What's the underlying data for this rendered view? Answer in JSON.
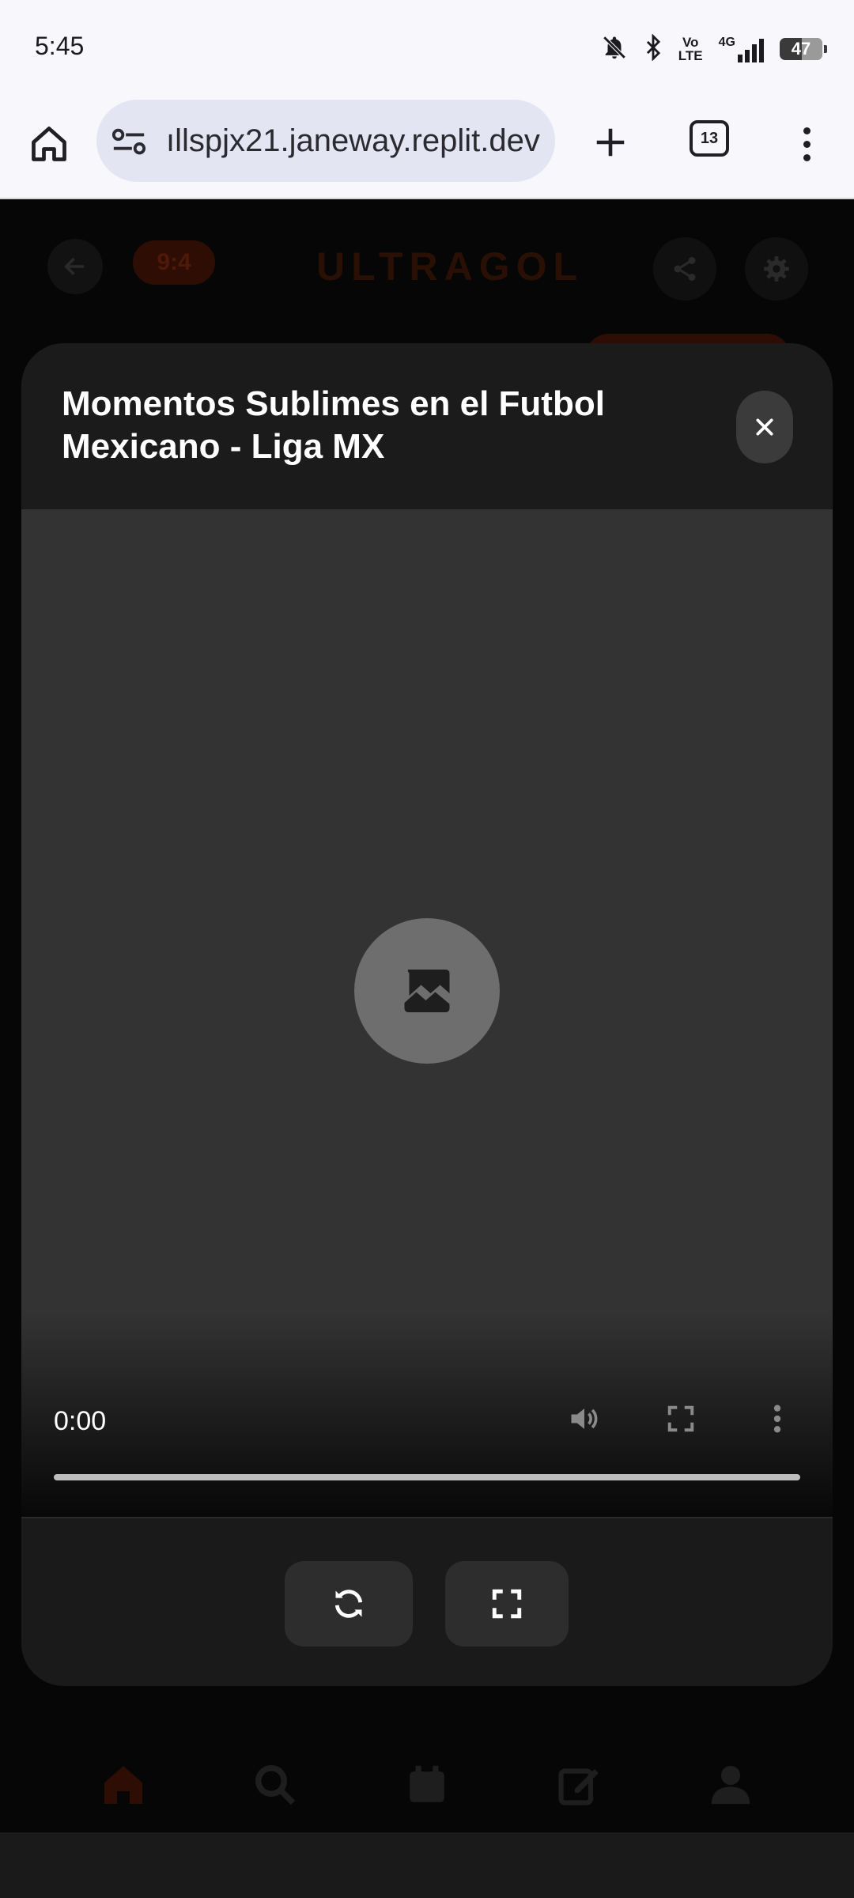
{
  "status_bar": {
    "time": "5:45",
    "volte": "Vo\nLTE",
    "network": "4G",
    "battery": "47"
  },
  "browser": {
    "url": "ıllspjx21.janeway.replit.dev",
    "tab_count": "13"
  },
  "app": {
    "score_badge": "9:4",
    "logo": "ULTRAGOL"
  },
  "modal": {
    "title": "Momentos Sublimes en el Futbol Mexicano - Liga MX",
    "close_symbol": "✕"
  },
  "player": {
    "time": "0:00",
    "progress": 0
  },
  "colors": {
    "accent": "#ff4500",
    "modal_bg": "#1a1a1a",
    "player_bg": "#333333"
  }
}
